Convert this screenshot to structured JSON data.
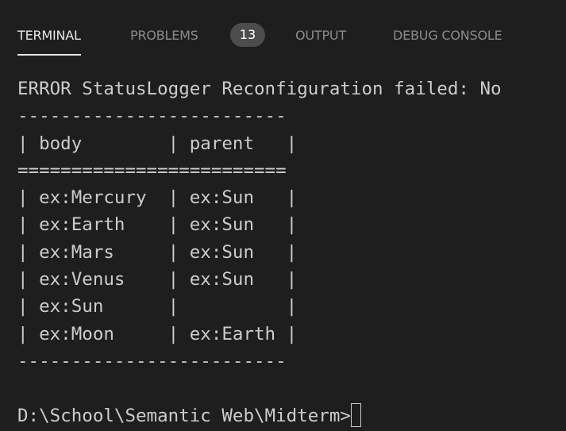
{
  "tabs": [
    {
      "label": "TERMINAL",
      "active": true
    },
    {
      "label": "PROBLEMS",
      "badge": "13",
      "active": false
    },
    {
      "label": "OUTPUT",
      "active": false
    },
    {
      "label": "DEBUG CONSOLE",
      "active": false
    }
  ],
  "terminal": {
    "lines": [
      "ERROR StatusLogger Reconfiguration failed: No",
      "-------------------------",
      "| body        | parent   |",
      "=========================",
      "| ex:Mercury  | ex:Sun   |",
      "| ex:Earth    | ex:Sun   |",
      "| ex:Mars     | ex:Sun   |",
      "| ex:Venus    | ex:Sun   |",
      "| ex:Sun      |          |",
      "| ex:Moon     | ex:Earth |",
      "-------------------------"
    ],
    "prompt": "D:\\School\\Semantic Web\\Midterm>"
  },
  "colors": {
    "background": "#1e1e1e",
    "text": "#cccccc",
    "tab_active": "#e7e7e7",
    "tab_inactive": "#8b8b8b",
    "badge_bg": "#4d4d4d"
  }
}
